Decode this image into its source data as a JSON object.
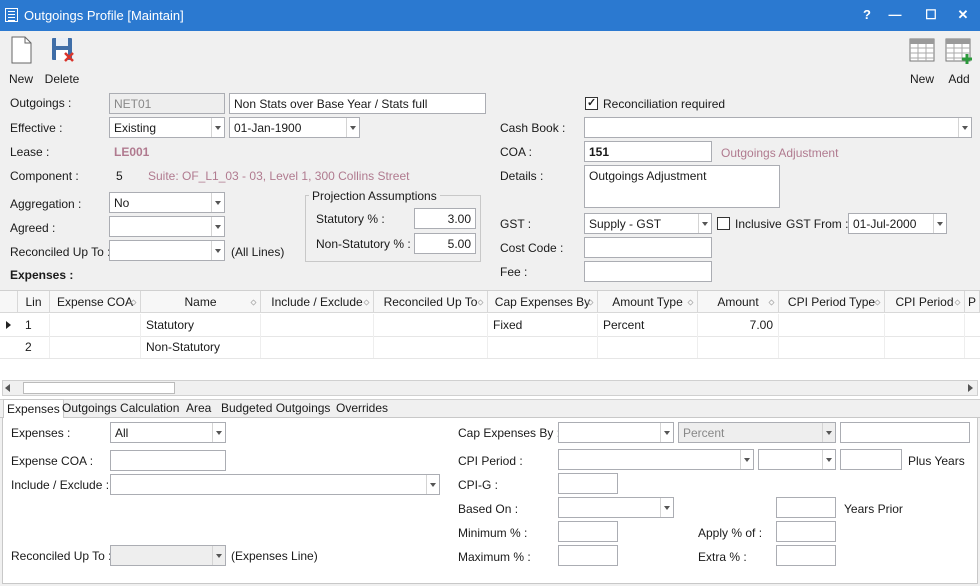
{
  "window": {
    "title": "Outgoings Profile [Maintain]",
    "help": "?",
    "minimize": "—",
    "maximize": "☐",
    "close": "✕"
  },
  "toolbar": {
    "new": "New",
    "delete": "Delete",
    "new_right": "New",
    "add": "Add"
  },
  "form": {
    "outgoings_label": "Outgoings :",
    "outgoings_code": "NET01",
    "outgoings_desc": "Non Stats over Base Year / Stats full",
    "effective_label": "Effective :",
    "effective_value": "Existing",
    "effective_date": "01-Jan-1900",
    "lease_label": "Lease :",
    "lease_value": "LE001",
    "component_label": "Component :",
    "component_value": "5",
    "component_suite": "Suite:  OF_L1_03 - 03, Level 1, 300 Collins Street",
    "aggregation_label": "Aggregation :",
    "aggregation_value": "No",
    "agreed_label": "Agreed :",
    "agreed_value": "",
    "reconciled_label": "Reconciled Up To :",
    "reconciled_value": "",
    "all_lines": "(All Lines)",
    "expenses_heading": "Expenses :",
    "projection_title": "Projection Assumptions",
    "statutory_label": "Statutory % :",
    "statutory_value": "3.00",
    "nonstat_label": "Non-Statutory % :",
    "nonstat_value": "5.00",
    "reconciliation_label": "Reconciliation required",
    "reconciliation_checked": true,
    "cashbook_label": "Cash Book :",
    "cashbook_value": "",
    "coa_label": "COA :",
    "coa_value": "151",
    "coa_desc": "Outgoings Adjustment",
    "details_label": "Details :",
    "details_value": "Outgoings Adjustment",
    "gst_label": "GST :",
    "gst_value": "Supply - GST",
    "inclusive_label": "Inclusive",
    "inclusive_checked": false,
    "gst_from_label": "GST From :",
    "gst_from_value": "01-Jul-2000",
    "cost_code_label": "Cost Code :",
    "cost_code_value": "",
    "fee_label": "Fee :",
    "fee_value": ""
  },
  "grid": {
    "columns": [
      "Lin",
      "Expense COA",
      "Name",
      "Include / Exclude",
      "Reconciled Up To",
      "Cap Expenses By",
      "Amount Type",
      "Amount",
      "CPI Period Type",
      "CPI Period",
      "P"
    ],
    "rows": [
      {
        "lin": "1",
        "coa": "",
        "name": "Statutory",
        "incl": "",
        "rec": "",
        "cap": "Fixed",
        "atype": "Percent",
        "amount": "7.00",
        "cpitype": "",
        "cpiperiod": ""
      },
      {
        "lin": "2",
        "coa": "",
        "name": "Non-Statutory",
        "incl": "",
        "rec": "",
        "cap": "",
        "atype": "",
        "amount": "",
        "cpitype": "",
        "cpiperiod": ""
      }
    ]
  },
  "tabs": [
    "Expenses",
    "Outgoings Calculation",
    "Area",
    "Budgeted Outgoings",
    "Overrides"
  ],
  "detail": {
    "expenses_label": "Expenses :",
    "expenses_value": "All",
    "expense_coa_label": "Expense COA :",
    "expense_coa_value": "",
    "incl_label": "Include / Exclude :",
    "incl_value": "",
    "reconciled_label": "Reconciled Up To :",
    "reconciled_value": "",
    "expenses_line": "(Expenses Line)",
    "cap_label": "Cap Expenses By :",
    "cap_value": "",
    "cap_type": "Percent",
    "cap_extra": "",
    "cpi_period_label": "CPI Period :",
    "cpi_period_value": "",
    "cpi_period_2": "",
    "plus_years_value": "",
    "plus_years": "Plus Years",
    "cpig_label": "CPI-G :",
    "cpig_value": "",
    "based_on_label": "Based On :",
    "based_on_value": "",
    "years_prior_value": "",
    "years_prior": "Years Prior",
    "minimum_label": "Minimum % :",
    "minimum_value": "",
    "apply_label": "Apply % of :",
    "apply_value": "",
    "maximum_label": "Maximum % :",
    "maximum_value": "",
    "extra_label": "Extra % :",
    "extra_value": ""
  }
}
